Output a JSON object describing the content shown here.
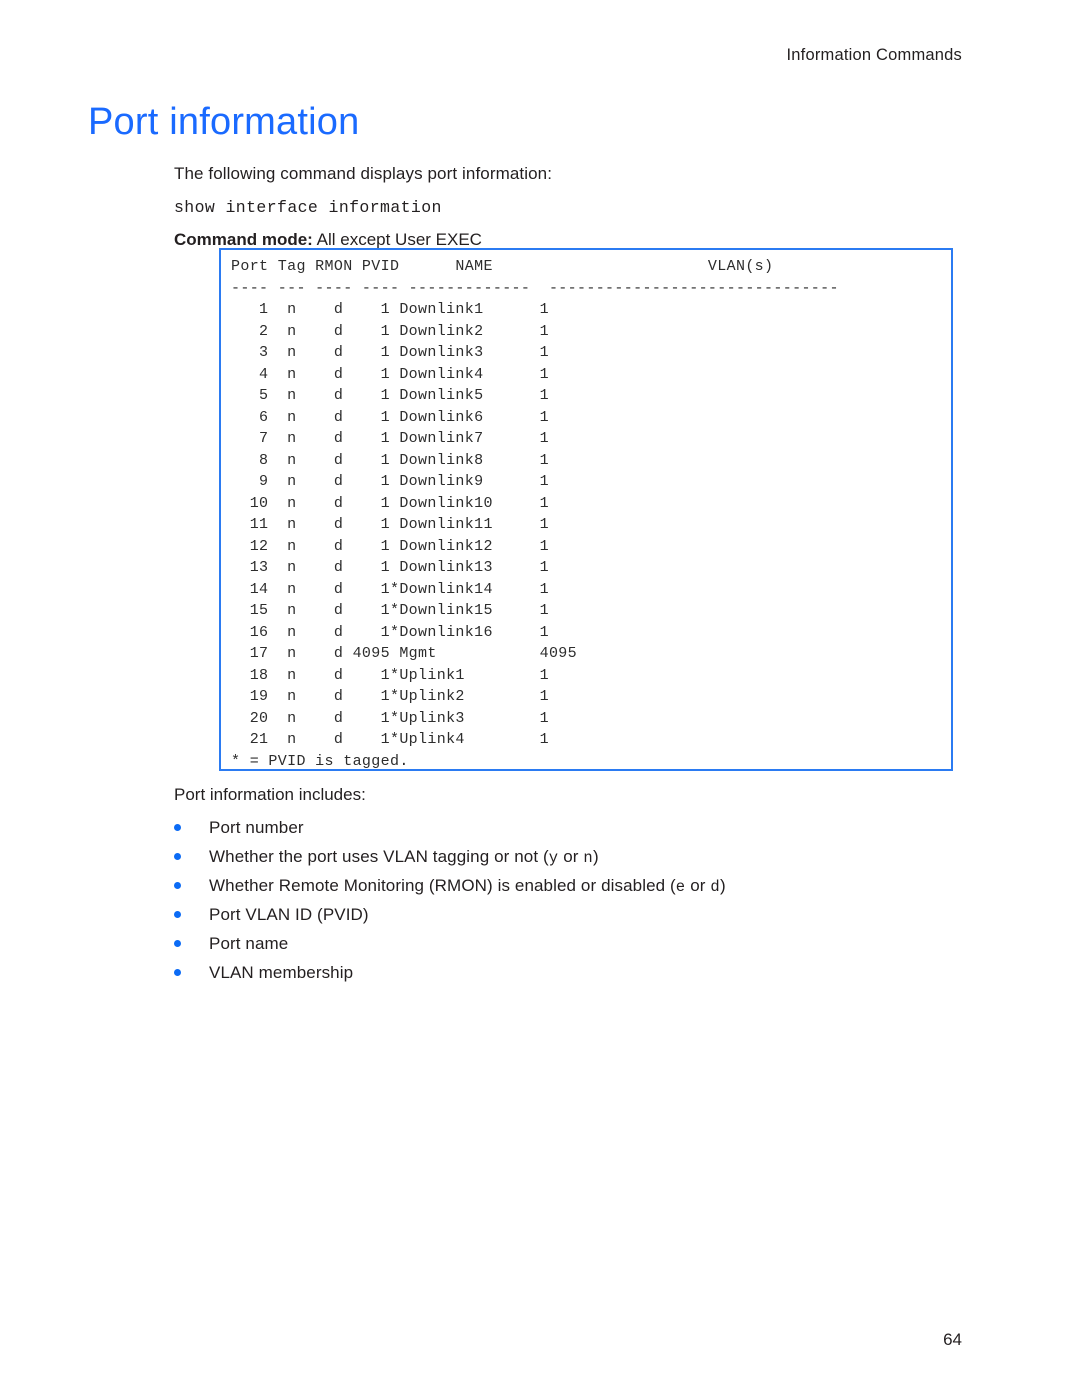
{
  "header": {
    "running_head": "Information Commands"
  },
  "title": "Port information",
  "body": {
    "intro": "The following command displays port information:",
    "cli_command": "show interface information",
    "command_mode_label": "Command mode:",
    "command_mode_value": " All except User EXEC",
    "includes_lead": "Port information includes:"
  },
  "output": {
    "columns": [
      "Port",
      "Tag",
      "RMON",
      "PVID",
      "NAME",
      "VLAN(s)"
    ],
    "header_line": "Port Tag RMON PVID      NAME                       VLAN(s)",
    "separator_line": "---- --- ---- ---- -------------  -------------------------------",
    "rows": [
      {
        "port": "1",
        "tag": "n",
        "rmon": "d",
        "pvid": "1",
        "tagged": false,
        "name": "Downlink1",
        "vlans": "1"
      },
      {
        "port": "2",
        "tag": "n",
        "rmon": "d",
        "pvid": "1",
        "tagged": false,
        "name": "Downlink2",
        "vlans": "1"
      },
      {
        "port": "3",
        "tag": "n",
        "rmon": "d",
        "pvid": "1",
        "tagged": false,
        "name": "Downlink3",
        "vlans": "1"
      },
      {
        "port": "4",
        "tag": "n",
        "rmon": "d",
        "pvid": "1",
        "tagged": false,
        "name": "Downlink4",
        "vlans": "1"
      },
      {
        "port": "5",
        "tag": "n",
        "rmon": "d",
        "pvid": "1",
        "tagged": false,
        "name": "Downlink5",
        "vlans": "1"
      },
      {
        "port": "6",
        "tag": "n",
        "rmon": "d",
        "pvid": "1",
        "tagged": false,
        "name": "Downlink6",
        "vlans": "1"
      },
      {
        "port": "7",
        "tag": "n",
        "rmon": "d",
        "pvid": "1",
        "tagged": false,
        "name": "Downlink7",
        "vlans": "1"
      },
      {
        "port": "8",
        "tag": "n",
        "rmon": "d",
        "pvid": "1",
        "tagged": false,
        "name": "Downlink8",
        "vlans": "1"
      },
      {
        "port": "9",
        "tag": "n",
        "rmon": "d",
        "pvid": "1",
        "tagged": false,
        "name": "Downlink9",
        "vlans": "1"
      },
      {
        "port": "10",
        "tag": "n",
        "rmon": "d",
        "pvid": "1",
        "tagged": false,
        "name": "Downlink10",
        "vlans": "1"
      },
      {
        "port": "11",
        "tag": "n",
        "rmon": "d",
        "pvid": "1",
        "tagged": false,
        "name": "Downlink11",
        "vlans": "1"
      },
      {
        "port": "12",
        "tag": "n",
        "rmon": "d",
        "pvid": "1",
        "tagged": false,
        "name": "Downlink12",
        "vlans": "1"
      },
      {
        "port": "13",
        "tag": "n",
        "rmon": "d",
        "pvid": "1",
        "tagged": false,
        "name": "Downlink13",
        "vlans": "1"
      },
      {
        "port": "14",
        "tag": "n",
        "rmon": "d",
        "pvid": "1",
        "tagged": true,
        "name": "Downlink14",
        "vlans": "1"
      },
      {
        "port": "15",
        "tag": "n",
        "rmon": "d",
        "pvid": "1",
        "tagged": true,
        "name": "Downlink15",
        "vlans": "1"
      },
      {
        "port": "16",
        "tag": "n",
        "rmon": "d",
        "pvid": "1",
        "tagged": true,
        "name": "Downlink16",
        "vlans": "1"
      },
      {
        "port": "17",
        "tag": "n",
        "rmon": "d",
        "pvid": "4095",
        "tagged": false,
        "name": "Mgmt",
        "vlans": "4095"
      },
      {
        "port": "18",
        "tag": "n",
        "rmon": "d",
        "pvid": "1",
        "tagged": true,
        "name": "Uplink1",
        "vlans": "1"
      },
      {
        "port": "19",
        "tag": "n",
        "rmon": "d",
        "pvid": "1",
        "tagged": true,
        "name": "Uplink2",
        "vlans": "1"
      },
      {
        "port": "20",
        "tag": "n",
        "rmon": "d",
        "pvid": "1",
        "tagged": true,
        "name": "Uplink3",
        "vlans": "1"
      },
      {
        "port": "21",
        "tag": "n",
        "rmon": "d",
        "pvid": "1",
        "tagged": true,
        "name": "Uplink4",
        "vlans": "1"
      }
    ],
    "footnote": "* = PVID is tagged."
  },
  "bullets": [
    {
      "text": "Port number"
    },
    {
      "pre": "Whether the port uses VLAN tagging or not (",
      "mono1": "y",
      "mid": " or ",
      "mono2": "n",
      "post": ")"
    },
    {
      "pre": "Whether Remote Monitoring (RMON) is enabled or disabled (",
      "mono1": "e",
      "mid": " or ",
      "mono2": "d",
      "post": ")"
    },
    {
      "text": "Port VLAN ID (PVID)"
    },
    {
      "text": "Port name"
    },
    {
      "text": "VLAN membership"
    }
  ],
  "footer": {
    "page_number": "64"
  },
  "colors": {
    "title_blue": "#1a6aff",
    "box_border_blue": "#2b7bf2",
    "bullet_blue": "#0b6bf5",
    "text": "#231f20"
  }
}
